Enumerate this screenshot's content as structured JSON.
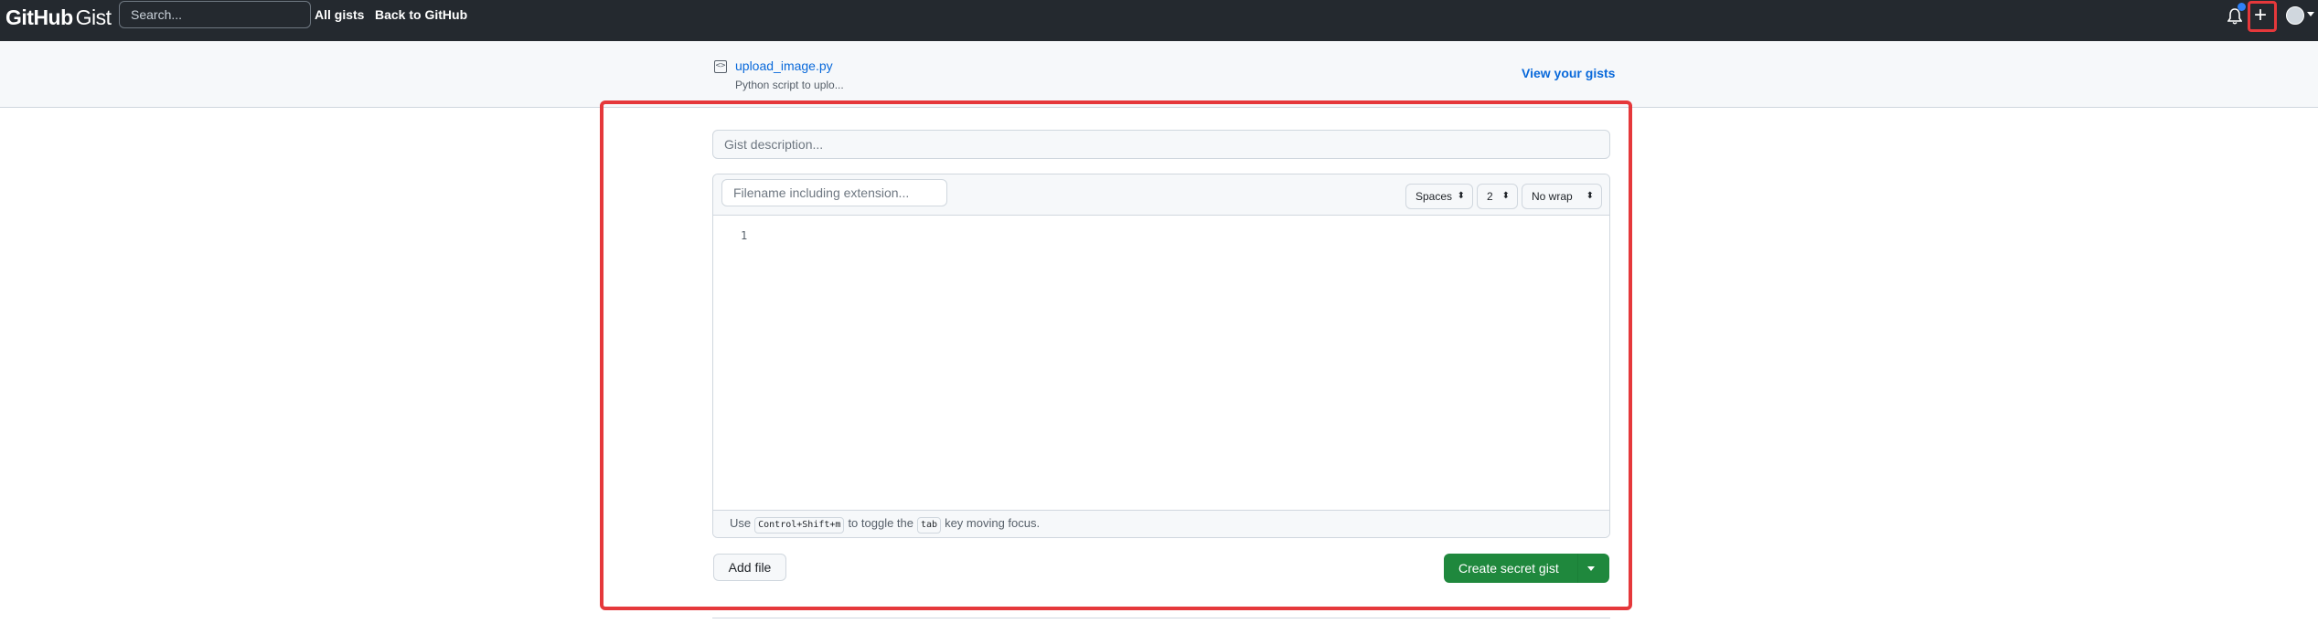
{
  "header": {
    "logo_main": "GitHub",
    "logo_sub": "Gist",
    "search_placeholder": "Search...",
    "nav": [
      "All gists",
      "Back to GitHub"
    ],
    "plus_label": "+"
  },
  "subheader": {
    "file_name": "upload_image.py",
    "file_desc": "Python script to uplo...",
    "view_gists": "View your gists"
  },
  "form": {
    "description_placeholder": "Gist description...",
    "filename_placeholder": "Filename including extension...",
    "indent_mode": "Spaces",
    "indent_size": "2",
    "wrap_mode": "No wrap",
    "line_number": "1",
    "footer_use": "Use",
    "footer_shortcut": "Control+Shift+m",
    "footer_mid": "to toggle the",
    "footer_key": "tab",
    "footer_end": "key moving focus.",
    "add_file": "Add file",
    "create_button": "Create secret gist"
  },
  "colors": {
    "header_bg": "#24292f",
    "link": "#0969da",
    "primary": "#1f883d",
    "highlight": "#e5383b",
    "notification_dot": "#2f81f7"
  }
}
